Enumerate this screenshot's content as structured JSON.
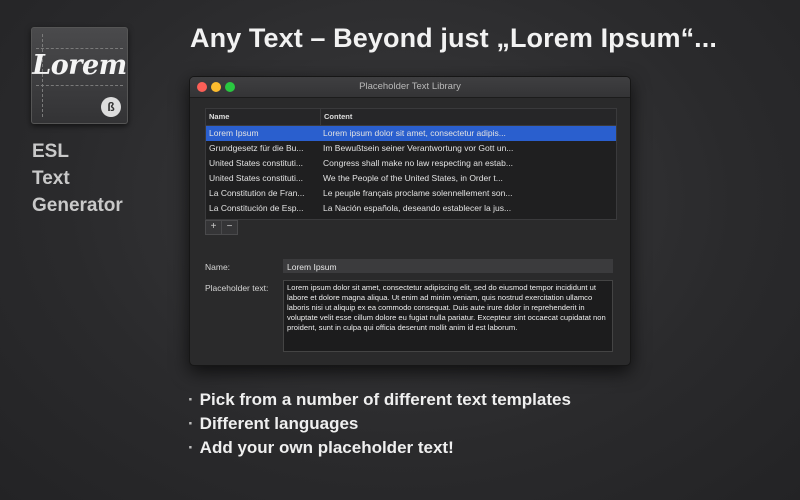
{
  "app_icon": {
    "logo_text": "Lorem",
    "badge": "ß"
  },
  "app_name": {
    "line1": "ESL",
    "line2": "Text",
    "line3": "Generator"
  },
  "headline": "Any Text – Beyond just „Lorem Ipsum“...",
  "window": {
    "title": "Placeholder Text Library",
    "table": {
      "columns": [
        "Name",
        "Content"
      ],
      "rows": [
        {
          "name": "Lorem Ipsum",
          "content": "Lorem ipsum dolor sit amet, consectetur adipis...",
          "selected": true
        },
        {
          "name": "Grundgesetz für die Bu...",
          "content": "Im Bewußtsein seiner Verantwortung vor Gott un..."
        },
        {
          "name": "United States constituti...",
          "content": "Congress shall make no law respecting an estab..."
        },
        {
          "name": "United States constituti...",
          "content": "We the People of the United States, in Order t..."
        },
        {
          "name": "La Constitution de Fran...",
          "content": "Le peuple français proclame solennellement son..."
        },
        {
          "name": "La Constitución de Esp...",
          "content": "La Nación española, deseando establecer la jus..."
        }
      ]
    },
    "add_label": "+",
    "remove_label": "−",
    "name_label": "Name:",
    "name_value": "Lorem Ipsum",
    "text_label": "Placeholder text:",
    "text_value": "Lorem ipsum dolor sit amet, consectetur adipiscing elit, sed do eiusmod tempor incididunt ut labore et dolore magna aliqua. Ut enim ad minim veniam, quis nostrud exercitation ullamco laboris nisi ut aliquip ex ea commodo consequat. Duis aute irure dolor in reprehenderit in voluptate velit esse cillum dolore eu fugiat nulla pariatur. Excepteur sint occaecat cupidatat non proident, sunt in culpa qui officia deserunt mollit anim id est laborum."
  },
  "bullets": [
    "Pick from a number of different text templates",
    "Different languages",
    "Add your own placeholder text!"
  ],
  "colors": {
    "selection": "#2a5fce",
    "close": "#fc5f57",
    "minimize": "#fdbc2e",
    "zoom": "#29c840"
  }
}
